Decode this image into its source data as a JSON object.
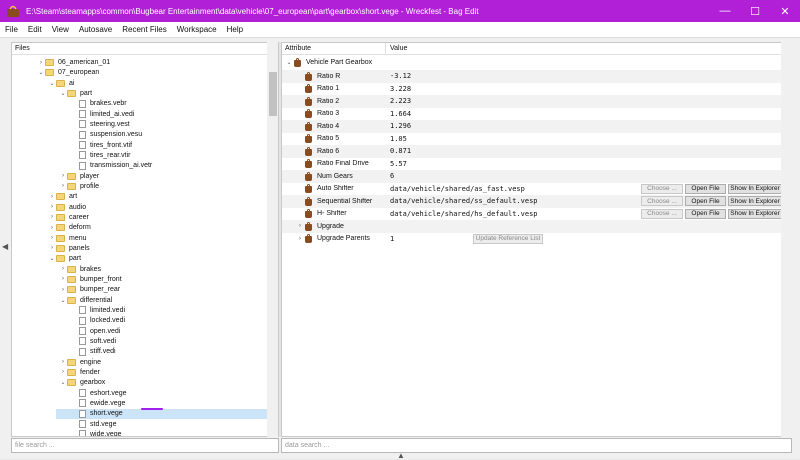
{
  "window": {
    "title": "E:\\Steam\\steamapps\\common\\Bugbear Entertainment\\data\\vehicle\\07_european\\part\\gearbox\\short.vege - Wreckfest - Bag Edit",
    "min_glyph": "—",
    "max_glyph": "☐",
    "close_glyph": "✕"
  },
  "menu": [
    "File",
    "Edit",
    "View",
    "Autosave",
    "Recent Files",
    "Workspace",
    "Help"
  ],
  "files": {
    "header": "Files",
    "search_placeholder": "file search ...",
    "tree": [
      {
        "label": "06_american_01",
        "kind": "folder",
        "depth": 1,
        "expanded": false
      },
      {
        "label": "07_european",
        "kind": "folder",
        "depth": 1,
        "expanded": true
      },
      {
        "label": "ai",
        "kind": "folder",
        "depth": 2,
        "expanded": true
      },
      {
        "label": "part",
        "kind": "folder",
        "depth": 3,
        "expanded": true
      },
      {
        "label": "brakes.vebr",
        "kind": "file",
        "depth": 4
      },
      {
        "label": "limited_ai.vedi",
        "kind": "file",
        "depth": 4
      },
      {
        "label": "steering.vest",
        "kind": "file",
        "depth": 4
      },
      {
        "label": "suspension.vesu",
        "kind": "file",
        "depth": 4
      },
      {
        "label": "tires_front.vtif",
        "kind": "file",
        "depth": 4
      },
      {
        "label": "tires_rear.vtir",
        "kind": "file",
        "depth": 4
      },
      {
        "label": "transmission_ai.vetr",
        "kind": "file",
        "depth": 4
      },
      {
        "label": "player",
        "kind": "folder",
        "depth": 3,
        "expanded": false
      },
      {
        "label": "profile",
        "kind": "folder",
        "depth": 3,
        "expanded": false
      },
      {
        "label": "art",
        "kind": "folder",
        "depth": 2,
        "expanded": false
      },
      {
        "label": "audio",
        "kind": "folder",
        "depth": 2,
        "expanded": false
      },
      {
        "label": "career",
        "kind": "folder",
        "depth": 2,
        "expanded": false
      },
      {
        "label": "deform",
        "kind": "folder",
        "depth": 2,
        "expanded": false
      },
      {
        "label": "menu",
        "kind": "folder",
        "depth": 2,
        "expanded": false
      },
      {
        "label": "panels",
        "kind": "folder",
        "depth": 2,
        "expanded": false
      },
      {
        "label": "part",
        "kind": "folder",
        "depth": 2,
        "expanded": true
      },
      {
        "label": "brakes",
        "kind": "folder",
        "depth": 3,
        "expanded": false
      },
      {
        "label": "bumper_front",
        "kind": "folder",
        "depth": 3,
        "expanded": false
      },
      {
        "label": "bumper_rear",
        "kind": "folder",
        "depth": 3,
        "expanded": false
      },
      {
        "label": "differential",
        "kind": "folder",
        "depth": 3,
        "expanded": true
      },
      {
        "label": "limited.vedi",
        "kind": "file",
        "depth": 4
      },
      {
        "label": "locked.vedi",
        "kind": "file",
        "depth": 4
      },
      {
        "label": "open.vedi",
        "kind": "file",
        "depth": 4
      },
      {
        "label": "soft.vedi",
        "kind": "file",
        "depth": 4
      },
      {
        "label": "stiff.vedi",
        "kind": "file",
        "depth": 4
      },
      {
        "label": "engine",
        "kind": "folder",
        "depth": 3,
        "expanded": false
      },
      {
        "label": "fender",
        "kind": "folder",
        "depth": 3,
        "expanded": false
      },
      {
        "label": "gearbox",
        "kind": "folder",
        "depth": 3,
        "expanded": true
      },
      {
        "label": "eshort.vege",
        "kind": "file",
        "depth": 4
      },
      {
        "label": "ewide.vege",
        "kind": "file",
        "depth": 4
      },
      {
        "label": "short.vege",
        "kind": "file",
        "depth": 4,
        "selected": true
      },
      {
        "label": "std.vege",
        "kind": "file",
        "depth": 4
      },
      {
        "label": "wide.vege",
        "kind": "file",
        "depth": 4
      }
    ]
  },
  "attributes": {
    "header_attr": "Attribute",
    "header_value": "Value",
    "search_placeholder": "data search ...",
    "root": "Vehicle Part Gearbox",
    "rows": [
      {
        "name": "Ratio R",
        "value": "-3.12"
      },
      {
        "name": "Ratio 1",
        "value": "3.228"
      },
      {
        "name": "Ratio 2",
        "value": "2.223"
      },
      {
        "name": "Ratio 3",
        "value": "1.664"
      },
      {
        "name": "Ratio 4",
        "value": "1.296"
      },
      {
        "name": "Ratio 5",
        "value": "1.05"
      },
      {
        "name": "Ratio 6",
        "value": "0.871"
      },
      {
        "name": "Ratio Final Drive",
        "value": "5.57"
      },
      {
        "name": "Num Gears",
        "value": "6"
      },
      {
        "name": "Auto Shifter",
        "value": "data/vehicle/shared/as_fast.vesp",
        "buttons": true
      },
      {
        "name": "Sequential Shifter",
        "value": "data/vehicle/shared/ss_default.vesp",
        "buttons": true
      },
      {
        "name": "H- Shifter",
        "value": "data/vehicle/shared/hs_default.vesp",
        "buttons": true
      },
      {
        "name": "Upgrade",
        "value": "",
        "expandable": true
      },
      {
        "name": "Upgrade Parents",
        "value": "1",
        "expandable": true,
        "update_button": true
      }
    ],
    "btn_choose": "Choose ...",
    "btn_open": "Open File",
    "btn_explorer": "Show In Explorer",
    "btn_update": "Update Reference List"
  },
  "colors": {
    "titlebar": "#b11fd7",
    "selection": "#cce4f7",
    "highlight_mark": "#a020f0"
  }
}
